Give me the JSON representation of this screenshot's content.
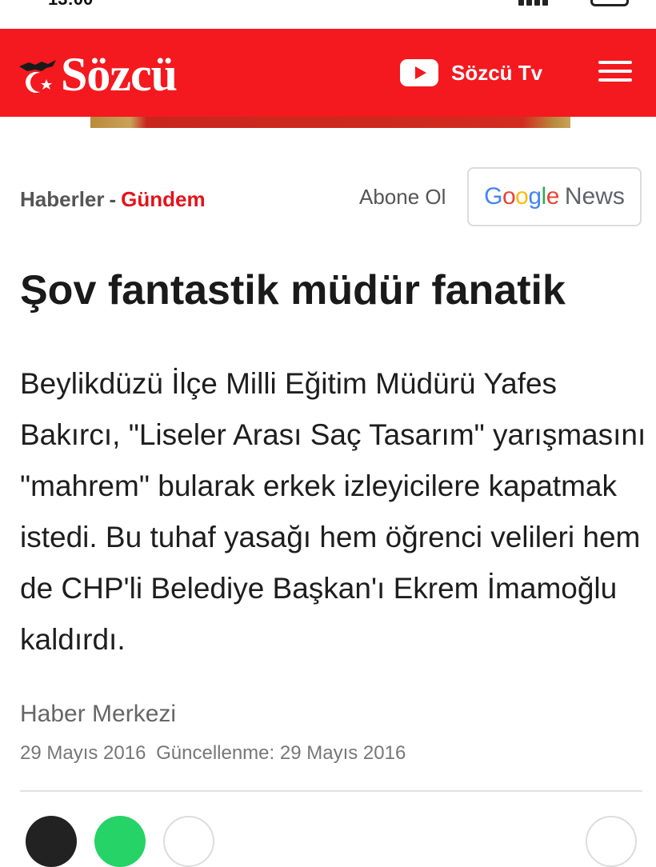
{
  "header": {
    "logo_text": "Sözcü",
    "tv_label": "Sözcü Tv",
    "tv_icon": "youtube-icon",
    "menu_icon": "hamburger-menu-icon",
    "brand_color": "#f3191f"
  },
  "breadcrumb": {
    "parent": "Haberler",
    "separator": "-",
    "current": "Gündem"
  },
  "subscribe": {
    "label": "Abone Ol",
    "google_parts": [
      "G",
      "o",
      "o",
      "g",
      "l",
      "e"
    ],
    "news_label": "News"
  },
  "article": {
    "title": "Şov fantastik müdür fanatik",
    "lead": "Beylikdüzü İlçe Milli Eğitim Müdürü Yafes Bakırcı, \"Liseler Arası Saç Tasarım\" yarışmasını \"mahrem\" bularak erkek izleyicilere kapatmak istedi. Bu tuhaf yasağı hem öğrenci velileri hem de CHP'li Belediye Başkan'ı Ekrem İmamoğlu kaldırdı.",
    "author": "Haber Merkezi",
    "published": "29 Mayıs 2016",
    "updated_label": "Güncellenme:",
    "updated": "29 Mayıs 2016"
  },
  "colors": {
    "accent_red": "#e3141b",
    "google_blue": "#4285f4",
    "google_red": "#ea4335",
    "google_yellow": "#fbbc05",
    "google_green": "#34a853"
  }
}
